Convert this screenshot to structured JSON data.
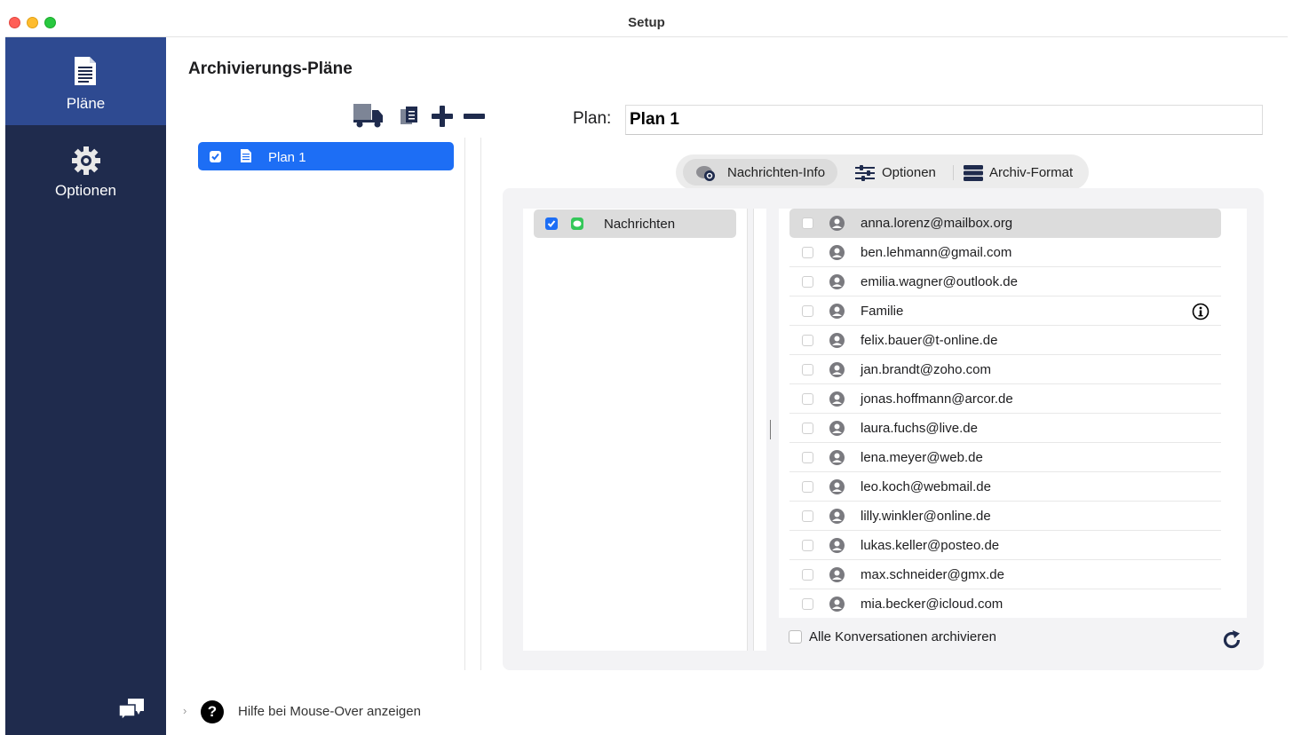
{
  "window": {
    "title": "Setup"
  },
  "sidebar": {
    "items": [
      {
        "label": "Pläne",
        "icon": "document-icon",
        "active": true
      },
      {
        "label": "Optionen",
        "icon": "gear-icon",
        "active": false
      }
    ],
    "footer_icon": "chat-bubbles-icon"
  },
  "plans": {
    "title": "Archivierungs-Pläne",
    "toolbar_icons": [
      "truck-icon",
      "duplicate-icon",
      "add-icon",
      "remove-icon"
    ],
    "items": [
      {
        "label": "Plan 1",
        "checked": true,
        "selected": true
      }
    ]
  },
  "plan_editor": {
    "plan_label": "Plan:",
    "plan_name": "Plan 1",
    "tabs": [
      {
        "label": "Nachrichten-Info",
        "icon": "message-info-icon",
        "active": true
      },
      {
        "label": "Optionen",
        "icon": "sliders-icon",
        "active": false
      },
      {
        "label": "Archiv-Format",
        "icon": "archive-stack-icon",
        "active": false
      }
    ]
  },
  "apps": [
    {
      "label": "Nachrichten",
      "checked": true,
      "icon": "messages-app-icon",
      "selected": true
    }
  ],
  "contacts": [
    {
      "label": "anna.lorenz@mailbox.org",
      "selected": true
    },
    {
      "label": "ben.lehmann@gmail.com"
    },
    {
      "label": "emilia.wagner@outlook.de"
    },
    {
      "label": "Familie",
      "info": true
    },
    {
      "label": "felix.bauer@t-online.de"
    },
    {
      "label": "jan.brandt@zoho.com"
    },
    {
      "label": "jonas.hoffmann@arcor.de"
    },
    {
      "label": "laura.fuchs@live.de"
    },
    {
      "label": "lena.meyer@web.de"
    },
    {
      "label": "leo.koch@webmail.de"
    },
    {
      "label": "lilly.winkler@online.de"
    },
    {
      "label": "lukas.keller@posteo.de"
    },
    {
      "label": "max.schneider@gmx.de"
    },
    {
      "label": "mia.becker@icloud.com"
    }
  ],
  "archive_all": {
    "label": "Alle Konversationen archivieren",
    "checked": false
  },
  "footer": {
    "help_label": "Hilfe bei Mouse-Over anzeigen",
    "chevron": "›",
    "help_glyph": "?"
  },
  "colors": {
    "sidebar": "#1f2b4d",
    "sidebar_active": "#2e4a91",
    "selection": "#1d6ef5"
  }
}
